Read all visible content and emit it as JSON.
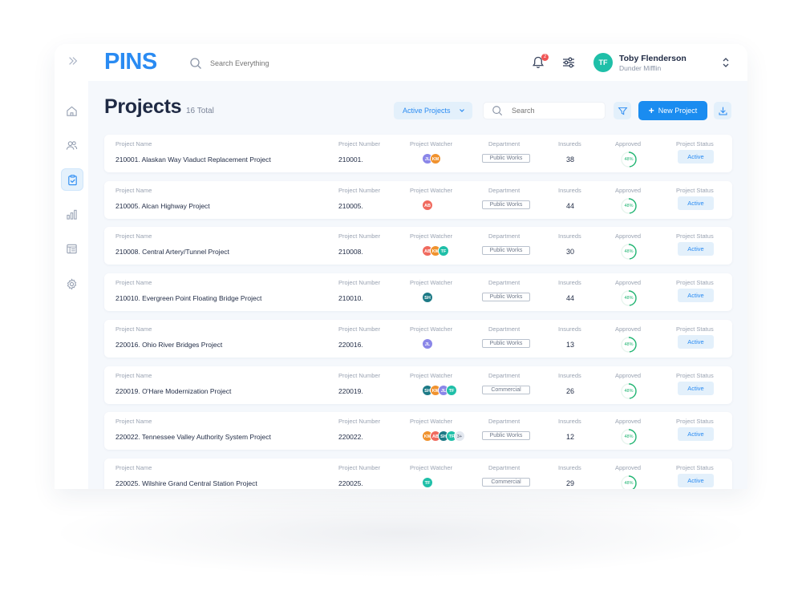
{
  "app": {
    "logo": "PINS",
    "search_placeholder": "Search Everything",
    "notification_count": "2",
    "user": {
      "initials": "TF",
      "name": "Toby Flenderson",
      "org": "Dunder Mifflin"
    }
  },
  "sidebar": {
    "items": [
      {
        "icon": "home-icon",
        "active": false
      },
      {
        "icon": "users-icon",
        "active": false
      },
      {
        "icon": "clipboard-check-icon",
        "active": true
      },
      {
        "icon": "bar-chart-icon",
        "active": false
      },
      {
        "icon": "table-icon",
        "active": false
      },
      {
        "icon": "gear-icon",
        "active": false
      }
    ]
  },
  "page": {
    "title": "Projects",
    "count": "16 Total",
    "filter_selected": "Active Projects",
    "search_placeholder": "Search",
    "new_button": "New Project"
  },
  "columns": {
    "name": "Project Name",
    "number": "Project Number",
    "watcher": "Project Watcher",
    "department": "Department",
    "insureds": "Insureds",
    "approved": "Approved",
    "status": "Project Status"
  },
  "projects": [
    {
      "name": "210001. Alaskan Way Viaduct Replacement Project",
      "number": "210001.",
      "watchers": [
        {
          "i": "JL",
          "c": "#8a86e8"
        },
        {
          "i": "KM",
          "c": "#f0922e"
        }
      ],
      "department": "Public Works",
      "insureds": "38",
      "approved": "48%",
      "approved_value": 0.48,
      "status": "Active"
    },
    {
      "name": "210005. Alcan Highway Project",
      "number": "210005.",
      "watchers": [
        {
          "i": "AB",
          "c": "#f06a5e"
        }
      ],
      "department": "Public Works",
      "insureds": "44",
      "approved": "48%",
      "approved_value": 0.48,
      "status": "Active"
    },
    {
      "name": "210008. Central Artery/Tunnel Project",
      "number": "210008.",
      "watchers": [
        {
          "i": "AB",
          "c": "#f06a5e"
        },
        {
          "i": "KM",
          "c": "#f0922e"
        },
        {
          "i": "TF",
          "c": "#1fbfa8"
        }
      ],
      "department": "Public Works",
      "insureds": "30",
      "approved": "48%",
      "approved_value": 0.48,
      "status": "Active"
    },
    {
      "name": "210010. Evergreen Point Floating Bridge Project",
      "number": "210010.",
      "watchers": [
        {
          "i": "SH",
          "c": "#1d7a86"
        }
      ],
      "department": "Public Works",
      "insureds": "44",
      "approved": "48%",
      "approved_value": 0.48,
      "status": "Active"
    },
    {
      "name": "220016. Ohio River Bridges Project",
      "number": "220016.",
      "watchers": [
        {
          "i": "JL",
          "c": "#8a86e8"
        }
      ],
      "department": "Public Works",
      "insureds": "13",
      "approved": "48%",
      "approved_value": 0.48,
      "status": "Active"
    },
    {
      "name": "220019. O'Hare Modernization Project",
      "number": "220019.",
      "watchers": [
        {
          "i": "SH",
          "c": "#1d7a86"
        },
        {
          "i": "KM",
          "c": "#f0922e"
        },
        {
          "i": "JL",
          "c": "#8a86e8"
        },
        {
          "i": "TF",
          "c": "#1fbfa8"
        }
      ],
      "department": "Commercial",
      "insureds": "26",
      "approved": "48%",
      "approved_value": 0.48,
      "status": "Active"
    },
    {
      "name": "220022. Tennessee Valley Authority System Project",
      "number": "220022.",
      "watchers": [
        {
          "i": "KM",
          "c": "#f0922e"
        },
        {
          "i": "AB",
          "c": "#f06a5e"
        },
        {
          "i": "SH",
          "c": "#1d7a86"
        },
        {
          "i": "TF",
          "c": "#1fbfa8"
        },
        {
          "i": "3+",
          "c": "#e3e8f0",
          "t": "#6f798b"
        }
      ],
      "department": "Public Works",
      "insureds": "12",
      "approved": "48%",
      "approved_value": 0.48,
      "status": "Active"
    },
    {
      "name": "220025. Wilshire Grand Central Station Project",
      "number": "220025.",
      "watchers": [
        {
          "i": "TF",
          "c": "#1fbfa8"
        }
      ],
      "department": "Commercial",
      "insureds": "29",
      "approved": "48%",
      "approved_value": 0.48,
      "status": "Active"
    }
  ]
}
